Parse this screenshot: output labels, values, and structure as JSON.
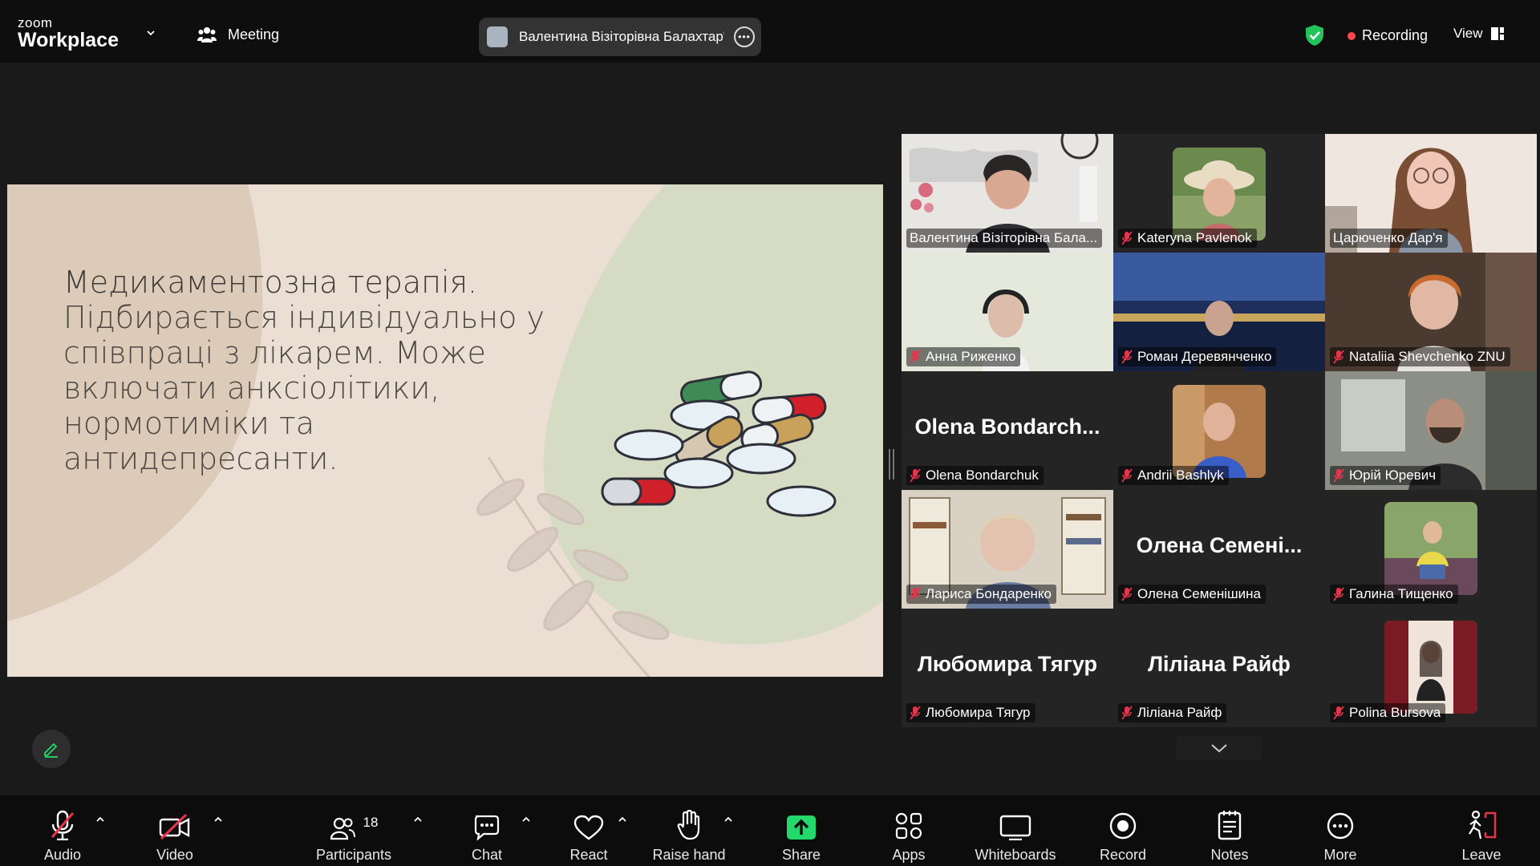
{
  "topbar": {
    "logo_small": "zoom",
    "logo_big": "Workplace",
    "meeting_label": "Meeting",
    "active_speaker": "Валентина Візіторівна Балахтар'",
    "recording_label": "Recording",
    "view_label": "View"
  },
  "slide": {
    "title": "Медикаментозна терапія.",
    "body": "Підбирається індивідуально у співпраці з лікарем. Може включати анксіолітики, нормотиміки та антидепресанти."
  },
  "participants": [
    {
      "name": "Валентина Візіторівна Бала...",
      "muted": false,
      "active": false
    },
    {
      "name": "Kateryna Pavlenok",
      "muted": true,
      "active": false
    },
    {
      "name": "Царюченко Дар'я",
      "muted": false,
      "active": true
    },
    {
      "name": "Анна Риженко",
      "muted": true,
      "active": false
    },
    {
      "name": "Роман Деревянченко",
      "muted": true,
      "active": false
    },
    {
      "name": "Nataliia Shevchenko ZNU",
      "muted": true,
      "active": false
    },
    {
      "name": "Olena Bondarchuk",
      "big_name": "Olena  Bondarch...",
      "muted": true,
      "active": false
    },
    {
      "name": "Andrii Bashlyk",
      "muted": true,
      "active": false
    },
    {
      "name": "Юрій Юревич",
      "muted": true,
      "active": false
    },
    {
      "name": "Лариса Бондаренко",
      "muted": true,
      "active": false
    },
    {
      "name": "Олена Семенішина",
      "big_name": "Олена  Семені...",
      "muted": true,
      "active": false
    },
    {
      "name": "Галина Тищенко",
      "muted": true,
      "active": false
    },
    {
      "name": "Любомира Тягур",
      "big_name": "Любомира Тягур",
      "muted": true,
      "active": false
    },
    {
      "name": "Ліліана Райф",
      "big_name": "Ліліана Райф",
      "muted": true,
      "active": false
    },
    {
      "name": "Polina Bursova",
      "muted": true,
      "active": false
    }
  ],
  "toolbar": {
    "audio": "Audio",
    "video": "Video",
    "participants": "Participants",
    "participants_count": "18",
    "chat": "Chat",
    "react": "React",
    "raise_hand": "Raise hand",
    "share": "Share",
    "apps": "Apps",
    "whiteboards": "Whiteboards",
    "record": "Record",
    "notes": "Notes",
    "more": "More",
    "leave": "Leave"
  },
  "colors": {
    "active_speaker_border": "#23d96b",
    "muted_mic": "#e8344a",
    "share_button": "#23d96b",
    "recording_dot": "#ff4848",
    "slide_background": "#ebdfd4",
    "slide_blob": "#d5dcc3"
  }
}
